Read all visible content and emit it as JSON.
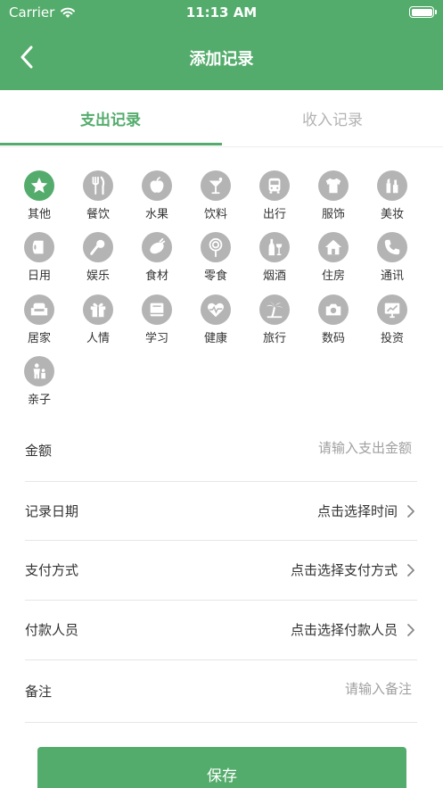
{
  "status_bar": {
    "carrier": "Carrier",
    "time": "11:13 AM",
    "battery_level": 1.0
  },
  "nav": {
    "title": "添加记录",
    "back_icon": "chevron-left-icon"
  },
  "tabs": [
    {
      "label": "支出记录",
      "active": true
    },
    {
      "label": "收入记录",
      "active": false
    }
  ],
  "categories": [
    {
      "label": "其他",
      "icon": "star-icon",
      "selected": true
    },
    {
      "label": "餐饮",
      "icon": "fork-knife-icon",
      "selected": false
    },
    {
      "label": "水果",
      "icon": "apple-icon",
      "selected": false
    },
    {
      "label": "饮料",
      "icon": "cocktail-icon",
      "selected": false
    },
    {
      "label": "出行",
      "icon": "bus-icon",
      "selected": false
    },
    {
      "label": "服饰",
      "icon": "shirt-icon",
      "selected": false
    },
    {
      "label": "美妆",
      "icon": "makeup-icon",
      "selected": false
    },
    {
      "label": "日用",
      "icon": "toilet-paper-icon",
      "selected": false
    },
    {
      "label": "娱乐",
      "icon": "microphone-icon",
      "selected": false
    },
    {
      "label": "食材",
      "icon": "vegetable-icon",
      "selected": false
    },
    {
      "label": "零食",
      "icon": "lollipop-icon",
      "selected": false
    },
    {
      "label": "烟酒",
      "icon": "wine-icon",
      "selected": false
    },
    {
      "label": "住房",
      "icon": "house-icon",
      "selected": false
    },
    {
      "label": "通讯",
      "icon": "phone-icon",
      "selected": false
    },
    {
      "label": "居家",
      "icon": "sofa-icon",
      "selected": false
    },
    {
      "label": "人情",
      "icon": "gift-icon",
      "selected": false
    },
    {
      "label": "学习",
      "icon": "book-icon",
      "selected": false
    },
    {
      "label": "健康",
      "icon": "heart-pulse-icon",
      "selected": false
    },
    {
      "label": "旅行",
      "icon": "palm-tree-icon",
      "selected": false
    },
    {
      "label": "数码",
      "icon": "camera-icon",
      "selected": false
    },
    {
      "label": "投资",
      "icon": "chart-icon",
      "selected": false
    },
    {
      "label": "亲子",
      "icon": "parent-child-icon",
      "selected": false
    }
  ],
  "form": {
    "amount": {
      "label": "金额",
      "placeholder": "请输入支出金额",
      "value": ""
    },
    "date": {
      "label": "记录日期",
      "value": "点击选择时间"
    },
    "payment_method": {
      "label": "支付方式",
      "value": "点击选择支付方式"
    },
    "payer": {
      "label": "付款人员",
      "value": "点击选择付款人员"
    },
    "note": {
      "label": "备注",
      "placeholder": "请输入备注",
      "value": ""
    }
  },
  "save_label": "保存",
  "colors": {
    "primary": "#54ac6c",
    "icon_gray": "#b4b4b4",
    "text": "#333333",
    "placeholder": "#a0a0a0",
    "divider": "#e6e6e6"
  }
}
